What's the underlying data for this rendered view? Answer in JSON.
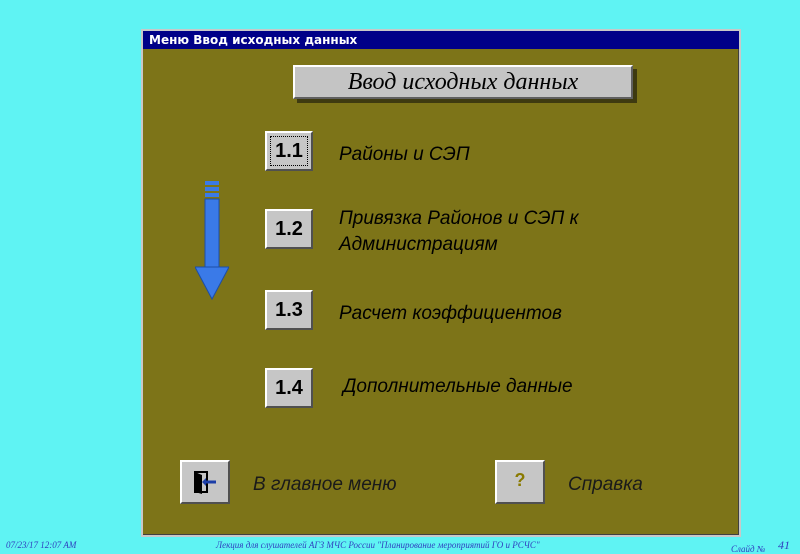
{
  "window": {
    "title": "Меню Ввод исходных данных"
  },
  "header": {
    "text": "Ввод исходных данных"
  },
  "menu": [
    {
      "num": "1.1",
      "label": "Районы и СЭП"
    },
    {
      "num": "1.2",
      "label_line1": "Привязка Районов и СЭП к",
      "label_line2": "Администрациям"
    },
    {
      "num": "1.3",
      "label": "Расчет коэффициентов"
    },
    {
      "num": "1.4",
      "label": "Дополнительные данные"
    }
  ],
  "bottom": {
    "main_menu_label": "В главное меню",
    "help_button_glyph": "?",
    "help_label": "Справка"
  },
  "footer": {
    "datetime": "07/23/17 12:07 AM",
    "lecture": "Лекция для слушателей АГЗ МЧС России \"Планирование мероприятий ГО и РСЧС\"",
    "slide_label": "Слайд №",
    "slide_number": "41"
  },
  "colors": {
    "background": "#5ff3f3",
    "window": "#7d7418",
    "titlebar": "#000088",
    "arrow": "#3a7ae8"
  }
}
